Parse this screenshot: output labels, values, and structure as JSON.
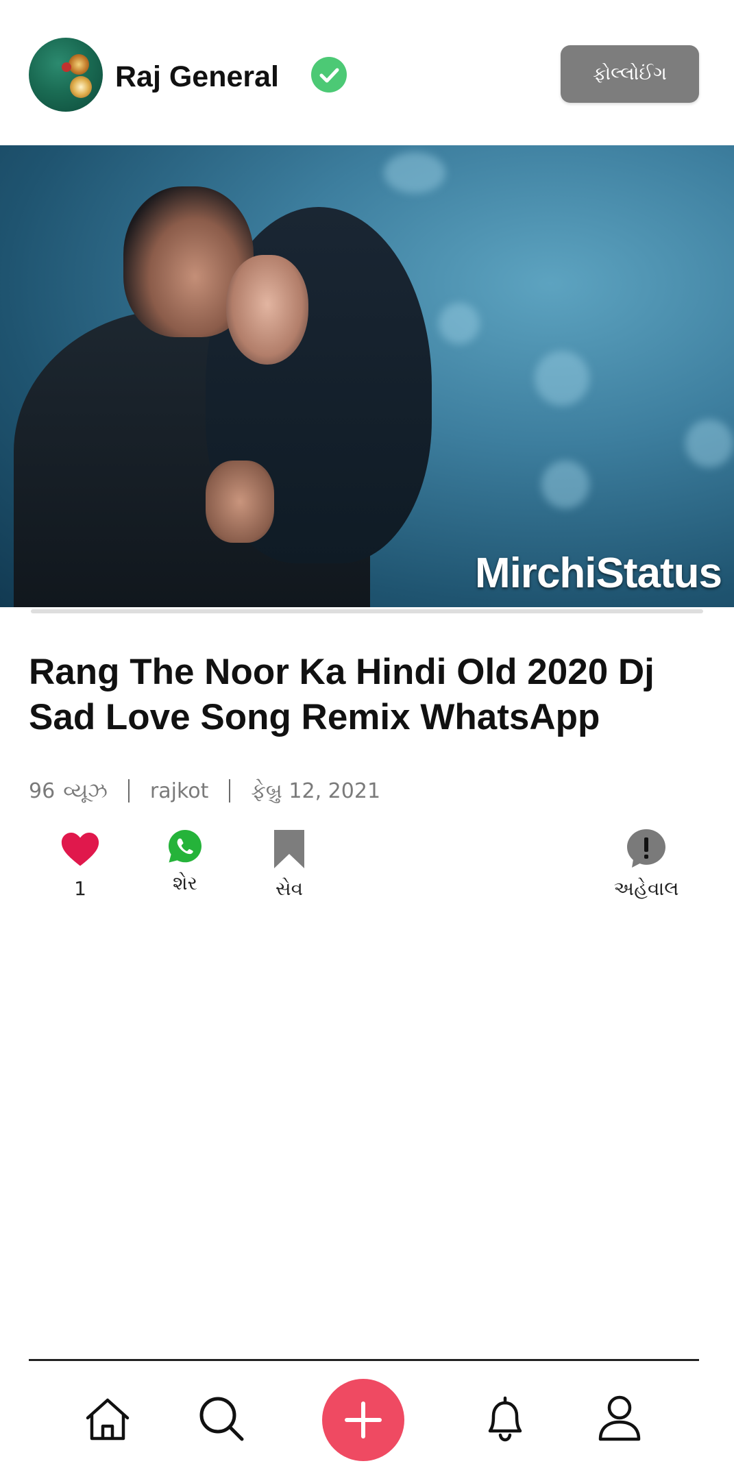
{
  "header": {
    "username": "Raj General",
    "follow_label": "ફોલ્લોઈંગ",
    "verified_color": "#4cc975"
  },
  "video": {
    "watermark": "MirchiStatus",
    "progress": 0.0
  },
  "post": {
    "title": "Rang The Noor Ka Hindi Old 2020 Dj Sad Love Song Remix WhatsApp",
    "views_count": "96",
    "views_label": "વ્યૂઝ",
    "location": "rajkot",
    "date": "ફેબ્રુ 12, 2021"
  },
  "actions": {
    "like_count": "1",
    "share_label": "શેર",
    "save_label": "સેવ",
    "report_label": "અહેવાલ",
    "like_color": "#e0184c",
    "share_color": "#25b33a"
  },
  "bottom_nav": {
    "items": [
      "home-icon",
      "search-icon",
      "add-icon",
      "bell-icon",
      "profile-icon"
    ],
    "add_color": "#ef4a62"
  }
}
